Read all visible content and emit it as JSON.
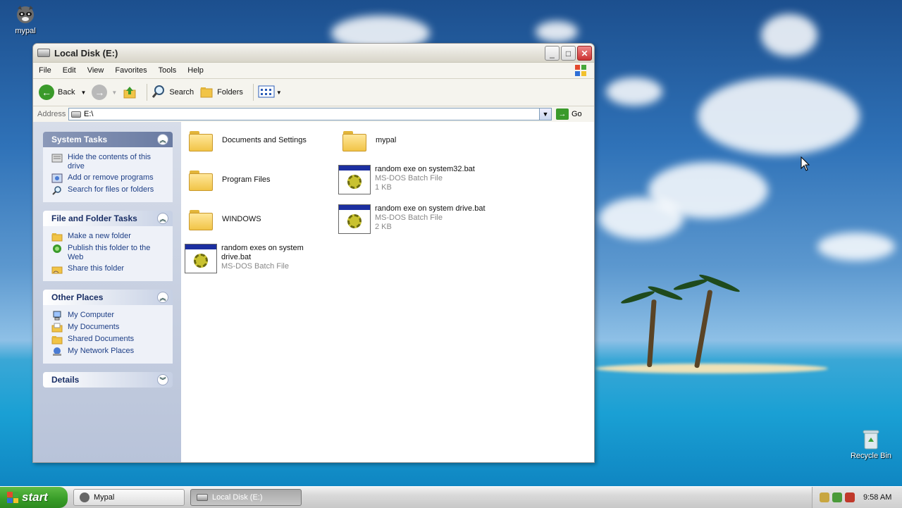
{
  "desktop": {
    "icons": [
      {
        "label": "mypal",
        "icon": "mypal-raccoon-icon"
      },
      {
        "label": "Recycle Bin",
        "icon": "recycle-bin-icon"
      }
    ]
  },
  "window": {
    "title": "Local Disk (E:)",
    "controls": {
      "minimize": "_",
      "maximize": "□",
      "close": "✕"
    },
    "menu": [
      "File",
      "Edit",
      "View",
      "Favorites",
      "Tools",
      "Help"
    ],
    "toolbar": {
      "back": "Back",
      "search": "Search",
      "folders": "Folders"
    },
    "address": {
      "label": "Address",
      "value": "E:\\",
      "go": "Go"
    },
    "task_pane": {
      "system_tasks": {
        "title": "System Tasks",
        "items": [
          "Hide the contents of this drive",
          "Add or remove programs",
          "Search for files or folders"
        ]
      },
      "file_folder_tasks": {
        "title": "File and Folder Tasks",
        "items": [
          "Make a new folder",
          "Publish this folder to the Web",
          "Share this folder"
        ]
      },
      "other_places": {
        "title": "Other Places",
        "items": [
          "My Computer",
          "My Documents",
          "Shared Documents",
          "My Network Places"
        ]
      },
      "details": {
        "title": "Details"
      }
    },
    "files": [
      {
        "name": "Documents and Settings",
        "type": "folder"
      },
      {
        "name": "mypal",
        "type": "folder"
      },
      {
        "name": "Program Files",
        "type": "folder"
      },
      {
        "name": "random exe on system32.bat",
        "type": "bat",
        "kind": "MS-DOS Batch File",
        "size": "1 KB"
      },
      {
        "name": "WINDOWS",
        "type": "folder"
      },
      {
        "name": "random exe on system drive.bat",
        "type": "bat",
        "kind": "MS-DOS Batch File",
        "size": "2 KB"
      },
      {
        "name": "random exes on system drive.bat",
        "type": "bat",
        "kind": "MS-DOS Batch File"
      }
    ]
  },
  "taskbar": {
    "start": "start",
    "buttons": [
      {
        "label": "Mypal",
        "active": false
      },
      {
        "label": "Local Disk (E:)",
        "active": true
      }
    ],
    "clock": "9:58 AM"
  }
}
